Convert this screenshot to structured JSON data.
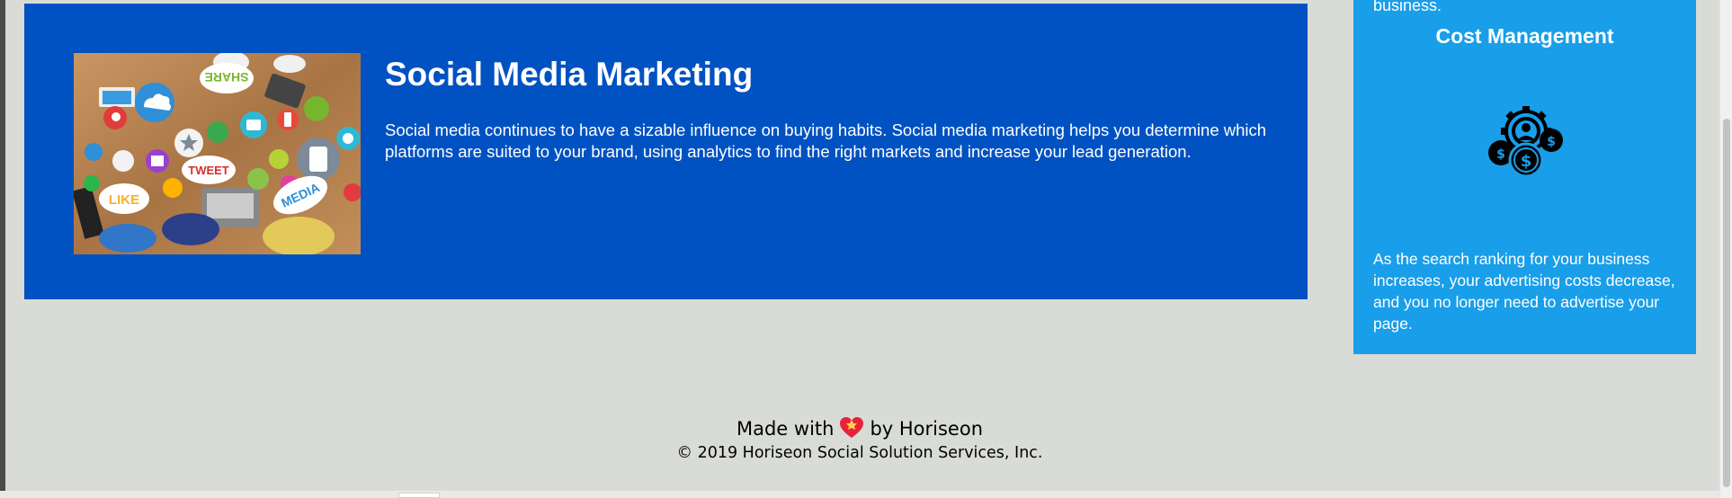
{
  "main_card": {
    "title": "Social Media Marketing",
    "text": "Social media continues to have a sizable influence on buying habits. Social media marketing helps you determine which platforms are suited to your brand, using analytics to find the right markets and increase your lead generation.",
    "image_words": {
      "share": "SHARE",
      "tweet": "TWEET",
      "like": "LIKE",
      "media": "MEDIA"
    },
    "background": "#0052c2"
  },
  "side_card": {
    "top_text": "business.",
    "title": "Cost Management",
    "icon": "cost-management-icon",
    "text": "As the search ranking for your business increases, your advertising costs decrease, and you no longer need to advertise your page.",
    "background": "#199ee9"
  },
  "footer": {
    "made_with": "Made with",
    "heart_icon": "heart-icon",
    "by": "by Horiseon",
    "copyright": "© 2019 Horiseon Social Solution Services, Inc."
  },
  "colors": {
    "page_background": "#d9dcd6",
    "text_light": "#ffffff",
    "text_dark": "#000000"
  }
}
